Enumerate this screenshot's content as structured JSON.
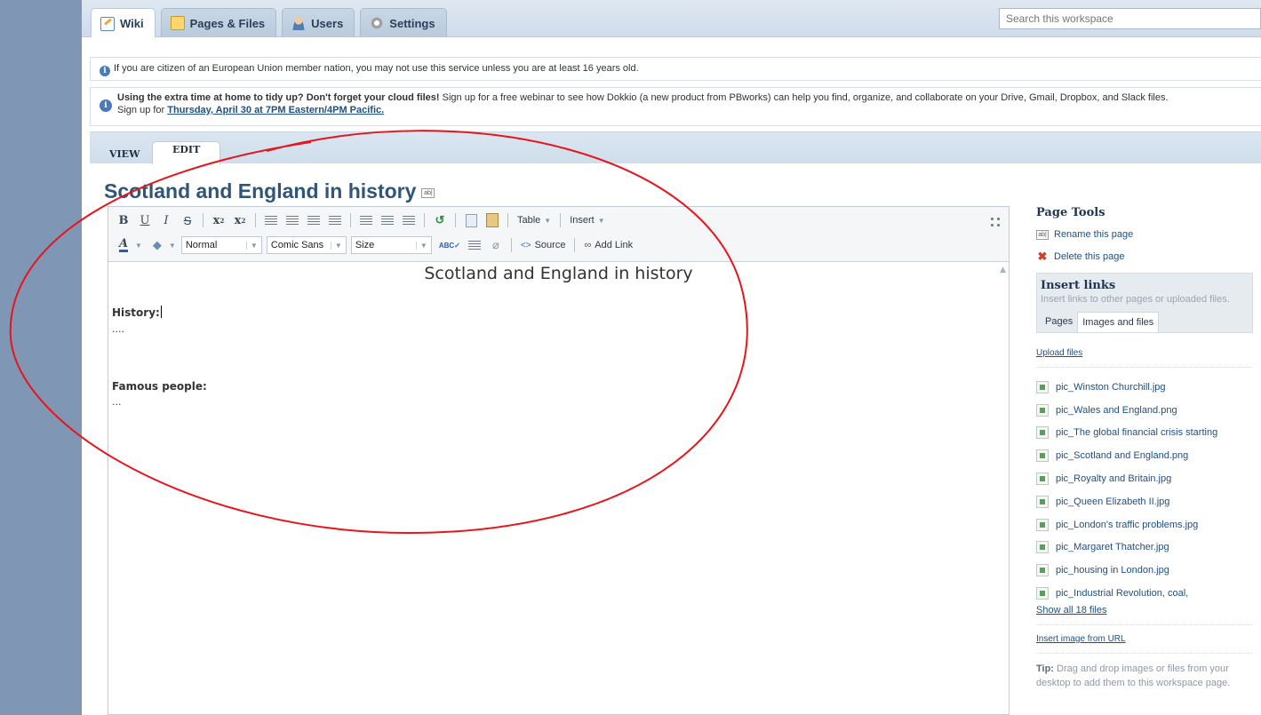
{
  "nav": {
    "tabs": [
      {
        "label": "Wiki",
        "icon": "wiki-icon"
      },
      {
        "label": "Pages & Files",
        "icon": "pages-icon"
      },
      {
        "label": "Users",
        "icon": "users-icon"
      },
      {
        "label": "Settings",
        "icon": "settings-icon"
      }
    ],
    "search_placeholder": "Search this workspace"
  },
  "notices": {
    "age": "If you are citizen of an European Union member nation, you may not use this service unless you are at least 16 years old.",
    "webinar_bold": "Using the extra time at home to tidy up? Don't forget your cloud files!",
    "webinar_text": " Sign up for a free webinar to see how Dokkio (a new product from PBworks) can help you find, organize, and collaborate on your Drive, Gmail, Dropbox, and Slack files.",
    "signup_prefix": "Sign up for ",
    "signup_link": "Thursday, April 30 at 7PM Eastern/4PM Pacific."
  },
  "view_tabs": {
    "view": "VIEW",
    "edit": "EDIT"
  },
  "page_title": "Scotland and England in history",
  "toolbar": {
    "table": "Table",
    "insert": "Insert",
    "format_value": "Normal",
    "font_value": "Comic Sans",
    "size_value": "Size",
    "source": "Source",
    "add_link": "Add Link"
  },
  "document": {
    "title": "Scotland and England in history",
    "history_label": "History:",
    "history_body": "....",
    "people_label": "Famous people:",
    "people_body": "..."
  },
  "side": {
    "page_tools_title": "Page Tools",
    "rename": "Rename this page",
    "delete": "Delete this page",
    "insert_links_title": "Insert links",
    "insert_links_desc": "Insert links to other pages or uploaded files.",
    "tab_pages": "Pages",
    "tab_images": "Images and files",
    "upload": "Upload files",
    "files": [
      "pic_Winston Churchill.jpg",
      "pic_Wales and England.png",
      "pic_The global financial crisis starting",
      "pic_Scotland and England.png",
      "pic_Royalty and Britain.jpg",
      "pic_Queen Elizabeth II.jpg",
      "pic_London's traffic problems.jpg",
      "pic_Margaret Thatcher.jpg",
      "pic_housing in London.jpg",
      "pic_Industrial Revolution, coal,"
    ],
    "show_all": "Show all 18 files",
    "insert_url": "Insert image from URL",
    "tip_label": "Tip:",
    "tip_text": " Drag and drop images or files from your desktop to add them to this workspace page."
  },
  "colors": {
    "annotation": "#e8141b",
    "page_bg": "#7f97b5",
    "title": "#2f5578"
  }
}
